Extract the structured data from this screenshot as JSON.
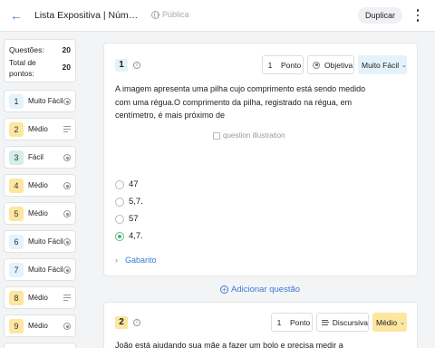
{
  "header": {
    "back_icon": "arrow-left-icon",
    "title": "Lista Expositiva | Números ...",
    "visibility_icon": "globe-icon",
    "visibility": "Pública",
    "duplicate_label": "Duplicar",
    "menu_icon": "more-vertical-icon"
  },
  "summary": {
    "questions_label": "Questões:",
    "questions_value": "20",
    "points_label": "Total de pontos:",
    "points_value": "20"
  },
  "sidebar": {
    "items": [
      {
        "number": "1",
        "label": "Muito Fácil",
        "indicator": "radio-icon"
      },
      {
        "number": "2",
        "label": "Médio",
        "indicator": "lines-icon"
      },
      {
        "number": "3",
        "label": "Fácil",
        "indicator": "radio-icon"
      },
      {
        "number": "4",
        "label": "Médio",
        "indicator": "radio-icon"
      },
      {
        "number": "5",
        "label": "Médio",
        "indicator": "radio-icon"
      },
      {
        "number": "6",
        "label": "Muito Fácil",
        "indicator": "radio-icon"
      },
      {
        "number": "7",
        "label": "Muito Fácil",
        "indicator": "radio-icon"
      },
      {
        "number": "8",
        "label": "Médio",
        "indicator": "lines-icon"
      },
      {
        "number": "9",
        "label": "Médio",
        "indicator": "radio-icon"
      }
    ]
  },
  "questions": [
    {
      "number": "1",
      "points": "1",
      "points_unit": "Ponto",
      "type": "Objetiva",
      "difficulty": "Muito Fácil",
      "text": "A imagem apresenta uma pilha cujo comprimento está sendo medido com uma régua.O comprimento da pilha, registrado na régua, em centímetro, é mais próximo de",
      "image_alt": "question illustration",
      "options": [
        "47",
        "5,7.",
        "57",
        "4,7."
      ],
      "selected_option": "4,7.",
      "answer_label": "Gabarito"
    },
    {
      "number": "2",
      "points": "1",
      "points_unit": "Ponto",
      "type": "Discursiva",
      "difficulty": "Médio",
      "text": "João está ajudando sua mãe a fazer um bolo e precisa medir a"
    }
  ],
  "add_question_label": "Adicionar questão",
  "colors": {
    "accent": "#3a7bd5",
    "easy_badge": "#e4f2fb",
    "medium_badge": "#fce6a0",
    "fácil_badge": "#d2efe9",
    "correct": "#4cb07a"
  }
}
